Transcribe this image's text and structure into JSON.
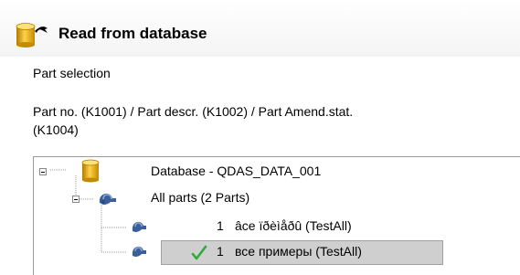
{
  "dialog": {
    "title": "Read from database",
    "section_label": "Part selection",
    "fields_line1": "Part no. (K1001) / Part descr. (K1002) / Part Amend.stat.",
    "fields_line2": "(K1004)"
  },
  "tree": {
    "root": {
      "label": "Database - QDAS_DATA_001",
      "icon": "database-icon",
      "expanded": true
    },
    "group": {
      "label": "All parts (2 Parts)",
      "icon": "parts-icon",
      "expanded": true
    },
    "items": [
      {
        "number": "1",
        "label": "âce ïðèìåðû (TestAll)",
        "icon": "part-icon",
        "checked": false,
        "selected": false
      },
      {
        "number": "1",
        "label": "все примеры (TestAll)",
        "icon": "part-icon",
        "checked": true,
        "selected": true
      }
    ]
  },
  "colors": {
    "database_icon": "#e8a800",
    "part_icon": "#3a5f9a",
    "check": "#2faa3a",
    "selection": "#cfcfcf"
  }
}
